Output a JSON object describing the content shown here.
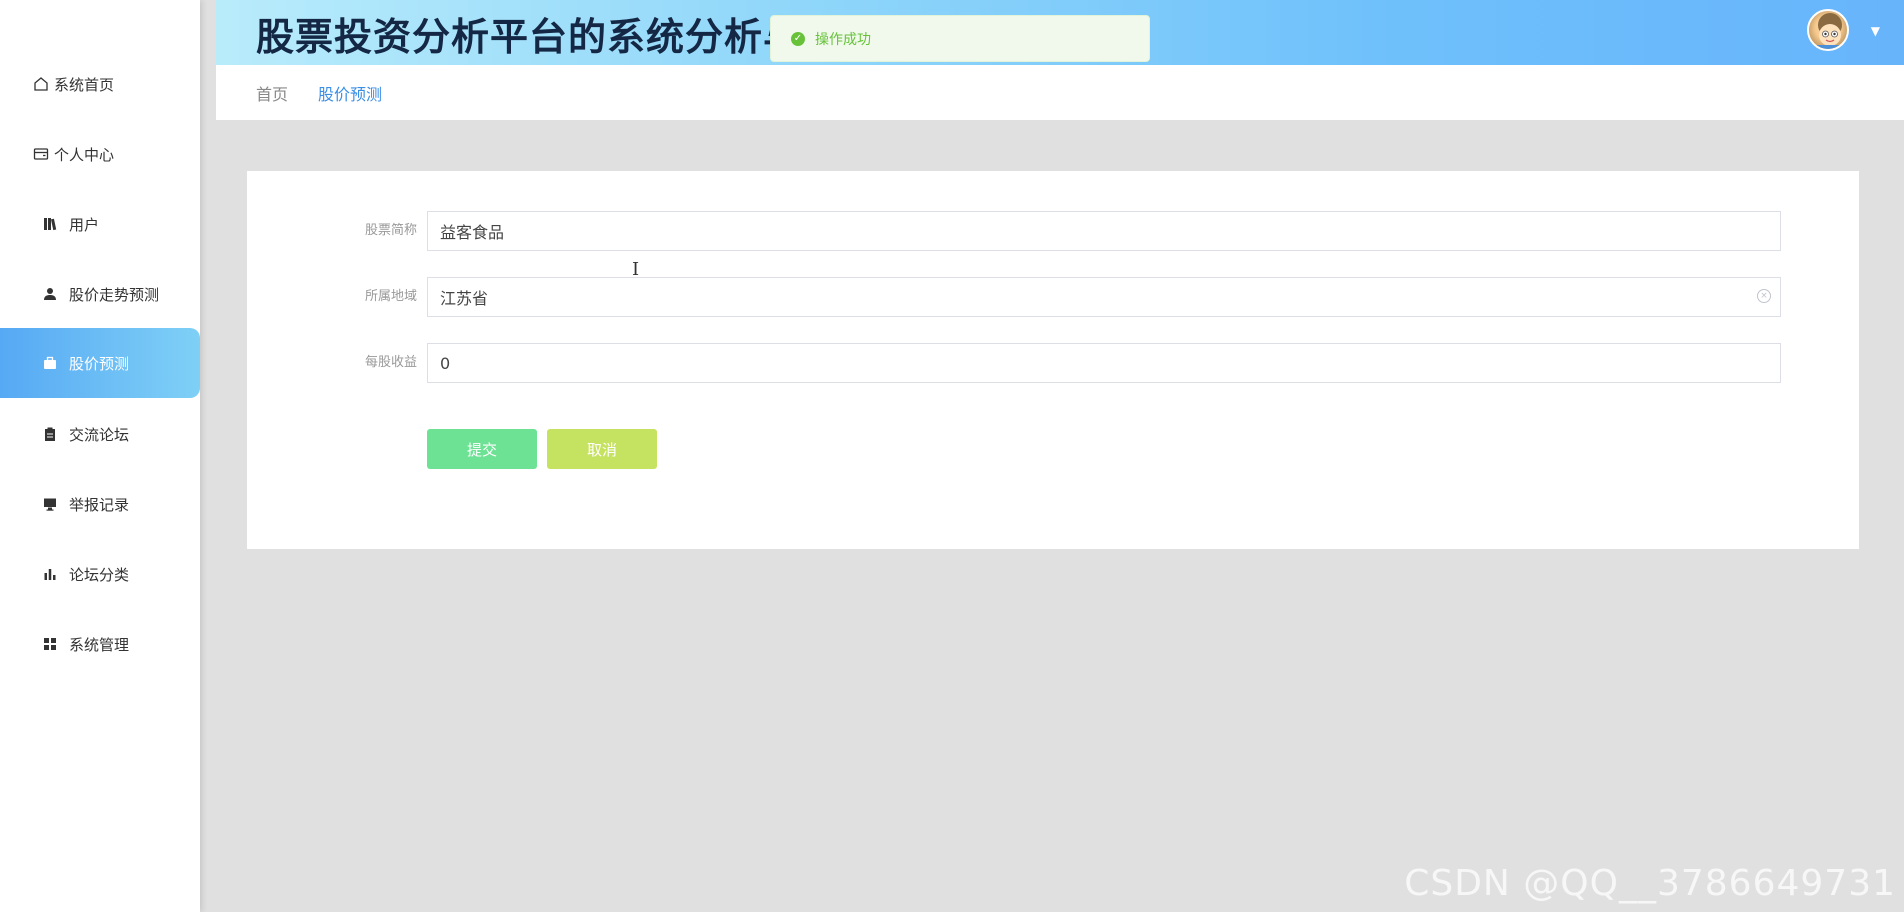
{
  "app": {
    "title": "股票投资分析平台的系统分析与设计"
  },
  "toast": {
    "message": "操作成功",
    "color": "#67c23a"
  },
  "sidebar": {
    "items": [
      {
        "label": "系统首页",
        "icon": "home-icon"
      },
      {
        "label": "个人中心",
        "icon": "wallet-icon"
      },
      {
        "label": "用户",
        "icon": "book-icon"
      },
      {
        "label": "股价走势预测",
        "icon": "user-icon"
      },
      {
        "label": "股价预测",
        "icon": "briefcase-icon",
        "active": true
      },
      {
        "label": "交流论坛",
        "icon": "clipboard-icon"
      },
      {
        "label": "举报记录",
        "icon": "monitor-icon"
      },
      {
        "label": "论坛分类",
        "icon": "bar-chart-icon"
      },
      {
        "label": "系统管理",
        "icon": "grid-icon"
      }
    ],
    "active_color": "#56a9f4"
  },
  "breadcrumb": {
    "home": "首页",
    "current": "股价预测"
  },
  "form": {
    "fields": [
      {
        "label": "股票简称",
        "value": "益客食品"
      },
      {
        "label": "所属地域",
        "value": "江苏省"
      },
      {
        "label": "每股收益",
        "value": "0"
      }
    ],
    "submit_label": "提交",
    "cancel_label": "取消"
  },
  "watermark": "CSDN @QQ__3786649731"
}
